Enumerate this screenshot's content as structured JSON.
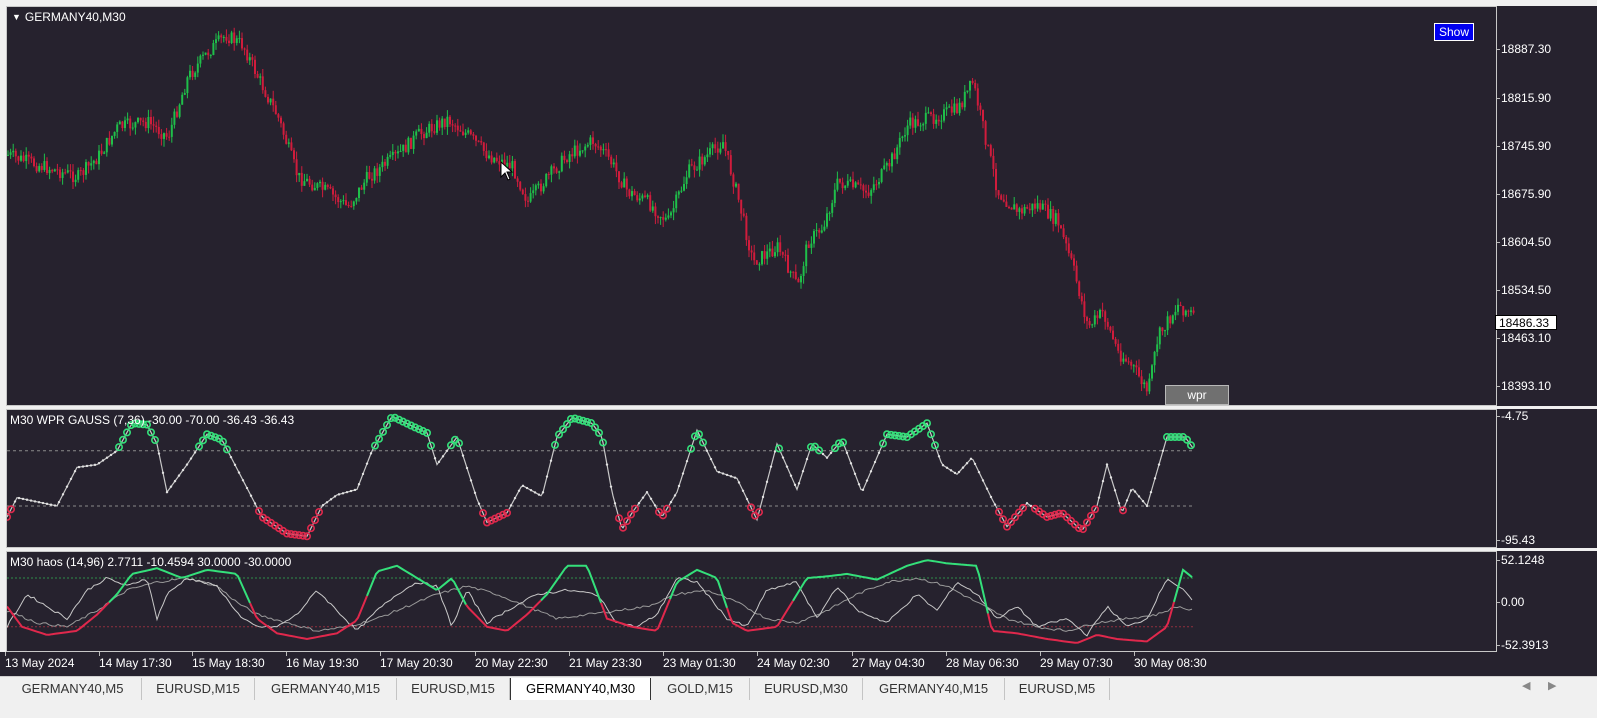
{
  "main": {
    "symbol_label": "GERMANY40,M30",
    "show_button": "Show",
    "wpr_button": "wpr",
    "current_price": "18486.33",
    "price_ticks": [
      "18887.30",
      "18815.90",
      "18745.90",
      "18675.90",
      "18604.50",
      "18534.50",
      "18463.10",
      "18393.10"
    ],
    "bull_color": "#1fbf4a",
    "bear_color": "#d01c3c",
    "background": "#26222e"
  },
  "wpr": {
    "label": "M30 WPR  GAUSS (7,36) -30.00 -70.00 -36.43 -36.43",
    "ticks": [
      "-4.75",
      "-95.43"
    ],
    "levels": [
      -30,
      -70
    ],
    "line_color": "#c8c8c8",
    "overbought_color": "#34e07a",
    "oversold_color": "#e0284c"
  },
  "haos": {
    "label": "M30 haos  (14,96) 2.7711 -10.4594 30.0000 -30.0000",
    "ticks": [
      "52.1248",
      "0.00",
      "-52.3913"
    ],
    "levels": [
      30,
      -30
    ],
    "up_color": "#34e07a",
    "down_color": "#e0284c",
    "line_color": "#c8c8c8"
  },
  "time_labels": [
    "13 May 2024",
    "14 May 17:30",
    "15 May 18:30",
    "16 May 19:30",
    "17 May 20:30",
    "20 May 22:30",
    "21 May 23:30",
    "23 May 01:30",
    "24 May 02:30",
    "27 May 04:30",
    "28 May 06:30",
    "29 May 07:30",
    "30 May 08:30"
  ],
  "tabs": [
    "GERMANY40,M5",
    "EURUSD,M15",
    "GERMANY40,M15",
    "EURUSD,M15",
    "GERMANY40,M30",
    "GOLD,M15",
    "EURUSD,M30",
    "GERMANY40,M15",
    "EURUSD,M5"
  ],
  "active_tab": "GERMANY40,M30",
  "scroll_left_icon": "◀",
  "scroll_right_icon": "▶"
}
